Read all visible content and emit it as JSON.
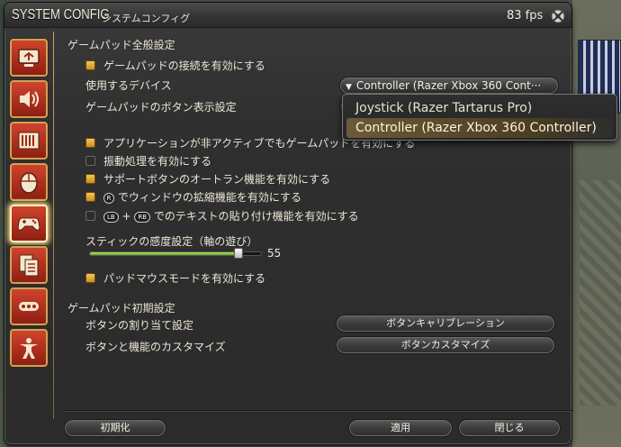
{
  "window": {
    "title_main": "SYSTEM CONFIG",
    "title_sub": "システムコンフィグ",
    "fps": "83 fps"
  },
  "sidebar": {
    "items": [
      {
        "icon": "monitor-icon"
      },
      {
        "icon": "speaker-icon"
      },
      {
        "icon": "hud-icon"
      },
      {
        "icon": "mouse-icon"
      },
      {
        "icon": "gamepad-icon",
        "active": true
      },
      {
        "icon": "documents-icon"
      },
      {
        "icon": "more-icon"
      },
      {
        "icon": "character-icon"
      }
    ]
  },
  "gamepad_general": {
    "section_title": "ゲームパッド全般設定",
    "enable_connection": "ゲームパッドの接続を有効にする",
    "device_label": "使用するデバイス",
    "device_value": "Controller (Razer Xbox 360 Cont···",
    "button_display_label": "ゲームパッドのボタン表示設定",
    "inactive_app": "アプリケーションが非アクティブでもゲームパッドを有効にする",
    "vibration": "振動処理を有効にする",
    "support_autorun": "サポートボタンのオートラン機能を有効にする",
    "window_zoom_key": "R",
    "window_zoom": "でウィンドウの拡縮機能を有効にする",
    "paste_key1": "LB",
    "paste_plus": "+",
    "paste_key2": "RB",
    "paste": "でのテキストの貼り付け機能を有効にする",
    "stick_label": "スティックの感度設定（軸の遊び）",
    "stick_value": "55",
    "stick_fraction": 0.55,
    "pad_mouse": "パッドマウスモードを有効にする"
  },
  "dropdown": {
    "options": [
      "Joystick (Razer Tartarus Pro)",
      "Controller (Razer Xbox 360 Controller)"
    ]
  },
  "gamepad_initial": {
    "section_title": "ゲームパッド初期設定",
    "button_assign_label": "ボタンの割り当て設定",
    "button_assign_btn": "ボタンキャリブレーション",
    "customize_label": "ボタンと機能のカスタマイズ",
    "customize_btn": "ボタンカスタマイズ"
  },
  "footer": {
    "reset": "初期化",
    "apply": "適用",
    "close": "閉じる"
  },
  "colors": {
    "accent": "#e8a83a",
    "slider": "#8ccc3d",
    "sidebar_button": "#b8301c"
  }
}
